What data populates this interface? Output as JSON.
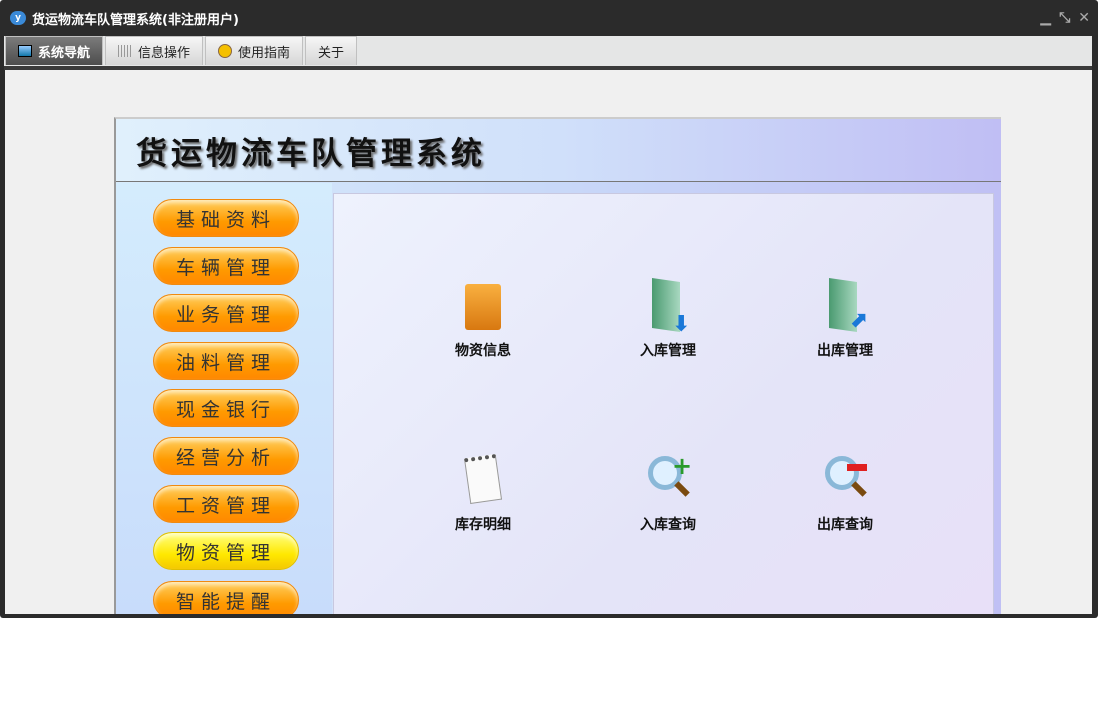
{
  "window": {
    "title": "货运物流车队管理系统(非注册用户)"
  },
  "tabs": [
    {
      "label": "系统导航"
    },
    {
      "label": "信息操作"
    },
    {
      "label": "使用指南"
    },
    {
      "label": "关于"
    }
  ],
  "app": {
    "title": "货运物流车队管理系统",
    "menu": [
      {
        "label": "基础资料"
      },
      {
        "label": "车辆管理"
      },
      {
        "label": "业务管理"
      },
      {
        "label": "油料管理"
      },
      {
        "label": "现金银行"
      },
      {
        "label": "经营分析"
      },
      {
        "label": "工资管理"
      },
      {
        "label": "物资管理"
      },
      {
        "label": "智能提醒"
      }
    ],
    "items": [
      {
        "label": "物资信息"
      },
      {
        "label": "入库管理"
      },
      {
        "label": "出库管理"
      },
      {
        "label": "库存明细"
      },
      {
        "label": "入库查询"
      },
      {
        "label": "出库查询"
      }
    ]
  }
}
